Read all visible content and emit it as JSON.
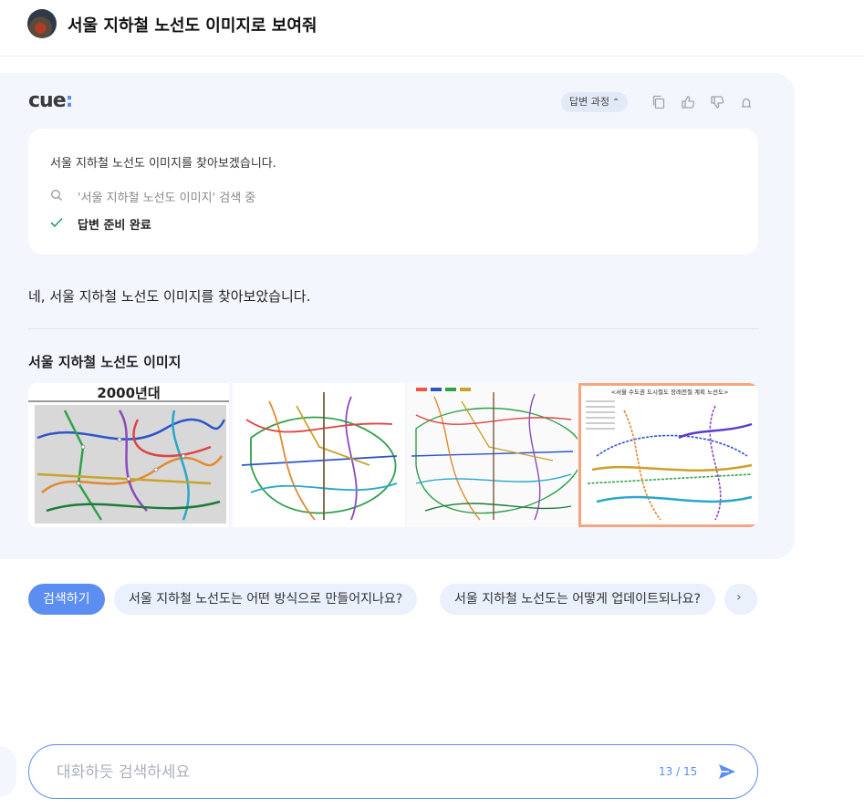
{
  "header": {
    "query": "서울 지하철 노선도 이미지로 보여줘",
    "avatar_icon": "user-avatar"
  },
  "card": {
    "logo_text": "cue",
    "logo_dot": ":",
    "process_label": "답변 과정",
    "actions": [
      "copy-icon",
      "thumbs-up-icon",
      "thumbs-down-icon",
      "alert-icon"
    ],
    "status_message": "서울 지하철 노선도 이미지를 찾아보겠습니다.",
    "search_step": "'서울 지하철 노선도 이미지' 검색 중",
    "done_step": "답변 준비 완료",
    "answer_text": "네, 서울 지하철 노선도 이미지를 찾아보았습니다.",
    "images_title": "서울 지하철 노선도 이미지",
    "images": [
      {
        "caption": "2000년대"
      },
      {
        "caption": ""
      },
      {
        "caption": ""
      },
      {
        "caption": "<서울 수도권 도시철도 장래전철 계획 노선도>"
      }
    ]
  },
  "suggestions": {
    "primary": "검색하기",
    "items": [
      "서울 지하철 노선도는 어떤 방식으로 만들어지나요?",
      "서울 지하철 노선도는 어떻게 업데이트되나요?"
    ],
    "next_icon": "chevron-right-icon"
  },
  "input": {
    "placeholder": "대화하듯 검색하세요",
    "value": "",
    "counter": "13 / 15",
    "send_icon": "send-icon"
  },
  "colors": {
    "accent": "#5b8ef0",
    "card_bg": "#f3f6fd",
    "check": "#2a9d6a"
  }
}
